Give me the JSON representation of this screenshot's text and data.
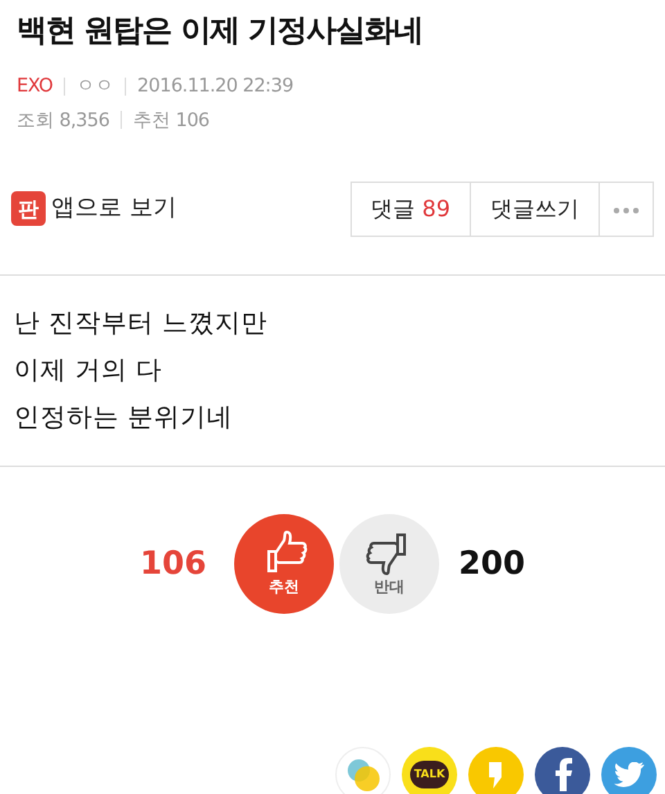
{
  "title": "백현 원탑은 이제 기정사실화네",
  "meta": {
    "category": "EXO",
    "author": "ㅇㅇ",
    "datetime": "2016.11.20 22:39",
    "views": "조회 8,356",
    "recommends": "추천 106"
  },
  "app_link": {
    "logo": "판",
    "label": "앱으로 보기"
  },
  "actions": [
    {
      "kind": "comments",
      "label": "댓글",
      "count": "89"
    },
    {
      "kind": "write",
      "label": "댓글쓰기"
    },
    {
      "kind": "more"
    }
  ],
  "body": [
    "난 진작부터 느꼈지만",
    "이제 거의 다",
    "인정하는 분위기네"
  ],
  "votes": {
    "up_count": "106",
    "up_label": "추천",
    "down_label": "반대",
    "down_count": "200"
  },
  "share": [
    {
      "kind": "story"
    },
    {
      "kind": "talk",
      "label": "TALK"
    },
    {
      "kind": "kakaostory"
    },
    {
      "kind": "facebook"
    },
    {
      "kind": "twitter"
    }
  ]
}
